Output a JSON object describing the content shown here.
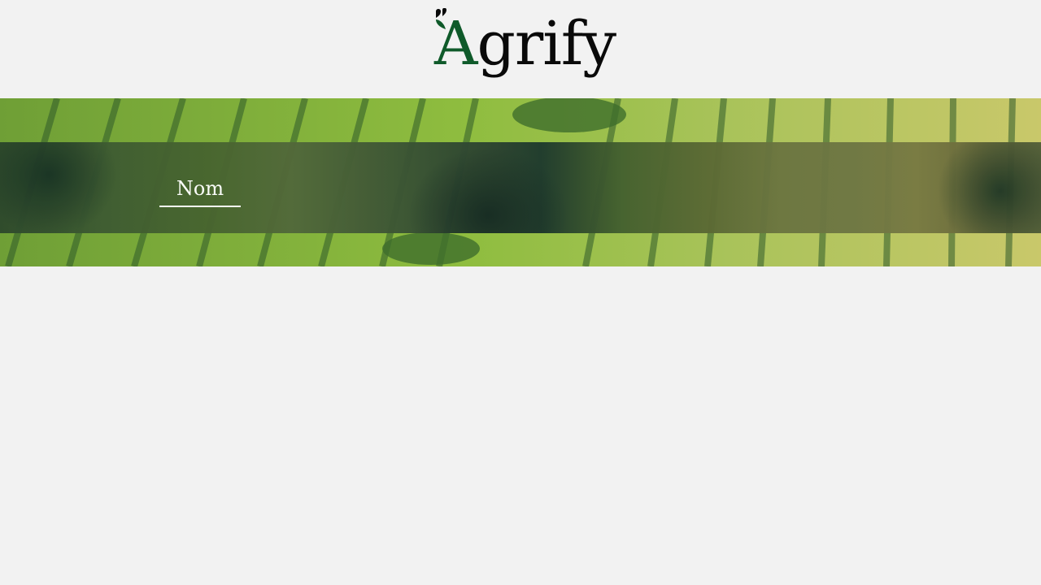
{
  "brand": {
    "name_first_letter": "A",
    "name_rest": "grify",
    "colors": {
      "first_letter": "#0f5a2a",
      "text": "#0a0a0a"
    }
  },
  "hero": {
    "tabs": [
      {
        "label": "Nom",
        "active": true
      }
    ]
  },
  "page": {
    "background": "#f2f2f2"
  }
}
